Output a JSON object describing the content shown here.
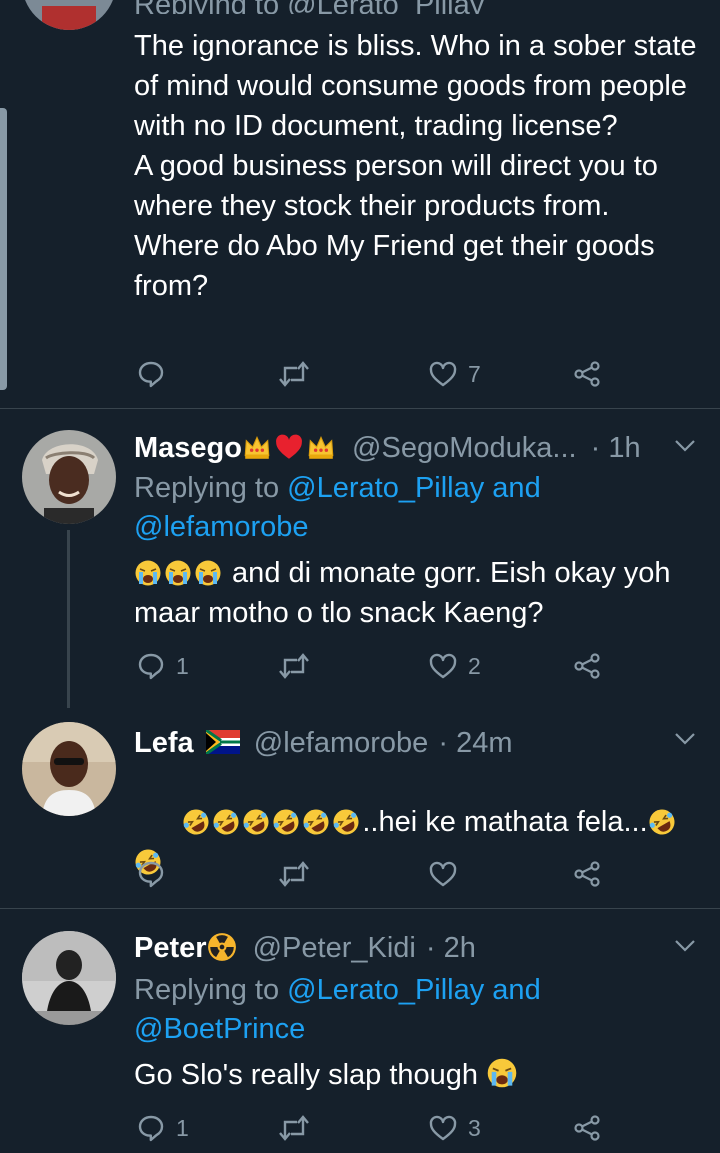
{
  "tweets": [
    {
      "reply_partial": "Replying to @Lerato_Pillay",
      "text": "The ignorance is bliss. Who in a sober state of mind would consume goods from people with no ID document, trading license?\nA good business person will direct you to where they stock their products from. Where do Abo My Friend get their goods from?",
      "actions": {
        "reply": "",
        "retweet": "",
        "like": "7"
      }
    },
    {
      "name": "Masego",
      "name_emoji": [
        "crown-emoji",
        "red-heart-emoji",
        "crown-emoji"
      ],
      "handle": "@SegoModuka...",
      "time": "· 1h",
      "reply_prefix": "Replying to ",
      "reply_mention_1": "@Lerato_Pillay and",
      "reply_mention_2": "@lefamorobe",
      "text_emoji": [
        "crying-face-emoji",
        "crying-face-emoji",
        "crying-face-emoji"
      ],
      "text": " and di monate gorr. Eish okay yoh maar motho o tlo snack Kaeng?",
      "actions": {
        "reply": "1",
        "retweet": "",
        "like": "2"
      }
    },
    {
      "name": "Lefa",
      "name_emoji": [
        "south-africa-flag-emoji"
      ],
      "handle": "@lefamorobe",
      "time": "· 24m",
      "text_emoji": [
        "rofl-emoji",
        "rofl-emoji",
        "rofl-emoji",
        "rofl-emoji",
        "rofl-emoji",
        "rofl-emoji"
      ],
      "text": "..hei ke mathata fela...",
      "text_emoji_after": [
        "rofl-emoji",
        "rofl-emoji"
      ],
      "actions": {
        "reply": "",
        "retweet": "",
        "like": ""
      }
    },
    {
      "name": "Peter",
      "name_emoji": [
        "radioactive-emoji"
      ],
      "handle": "@Peter_Kidi",
      "time": "· 2h",
      "reply_prefix": "Replying to ",
      "reply_mention_1": "@Lerato_Pillay and",
      "reply_mention_2": "@BoetPrince",
      "text": "Go Slo's really slap though ",
      "text_emoji_after": [
        "crying-face-emoji"
      ],
      "actions": {
        "reply": "1",
        "retweet": "",
        "like": "3"
      }
    }
  ],
  "colors": {
    "background": "#15202b",
    "divider": "#38444d",
    "secondary_text": "#8899a6",
    "link": "#1da1f2",
    "primary_text": "#ffffff"
  }
}
